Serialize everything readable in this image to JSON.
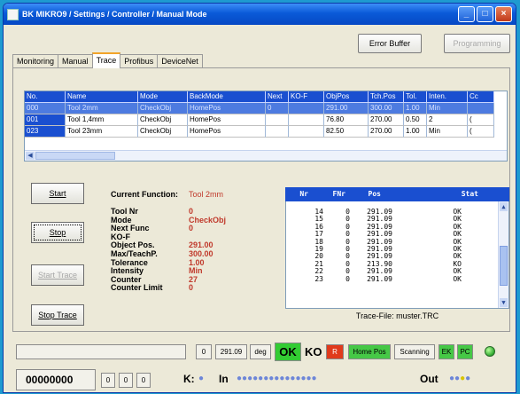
{
  "window": {
    "title": "BK MIKRO9 / Settings / Controller / Manual Mode"
  },
  "toolbar": {
    "error_buffer": "Error Buffer",
    "programming": "Programming"
  },
  "tabs": [
    "Monitoring",
    "Manual",
    "Trace",
    "Profibus",
    "DeviceNet"
  ],
  "grid": {
    "columns": [
      "No.",
      "Name",
      "Mode",
      "BackMode",
      "Next",
      "KO-F",
      "ObjPos",
      "Tch.Pos",
      "Tol.",
      "Inten.",
      "Cc"
    ],
    "rows": [
      [
        "000",
        "Tool 2mm",
        "CheckObj",
        "HomePos",
        "0",
        "",
        "291.00",
        "300.00",
        "1.00",
        "Min",
        ""
      ],
      [
        "001",
        "Tool 1,4mm",
        "CheckObj",
        "HomePos",
        "",
        "",
        "76.80",
        "270.00",
        "0.50",
        "2",
        "("
      ],
      [
        "023",
        "Tool 23mm",
        "CheckObj",
        "HomePos",
        "",
        "",
        "82.50",
        "270.00",
        "1.00",
        "Min",
        "("
      ]
    ]
  },
  "controls": {
    "start": "Start",
    "stop": "Stop",
    "start_trace": "Start Trace",
    "stop_trace": "Stop Trace"
  },
  "info": {
    "current_label": "Current Function:",
    "current_value": "Tool 2mm",
    "rows": [
      {
        "label": "Tool Nr",
        "value": "0"
      },
      {
        "label": "Mode",
        "value": "CheckObj"
      },
      {
        "label": "Next Func",
        "value": "0"
      },
      {
        "label": "KO-F",
        "value": ""
      },
      {
        "label": "Object Pos.",
        "value": "291.00"
      },
      {
        "label": "Max/TeachP.",
        "value": "300.00"
      },
      {
        "label": "Tolerance",
        "value": "1.00"
      },
      {
        "label": "Intensity",
        "value": "Min"
      },
      {
        "label": "Counter",
        "value": "27"
      },
      {
        "label": "Counter Limit",
        "value": "0"
      }
    ]
  },
  "trace": {
    "headers": [
      "Nr",
      "FNr",
      "Pos",
      "Stat"
    ],
    "rows": [
      [
        "14",
        "0",
        "291.09",
        "OK"
      ],
      [
        "15",
        "0",
        "291.09",
        "OK"
      ],
      [
        "16",
        "0",
        "291.09",
        "OK"
      ],
      [
        "17",
        "0",
        "291.09",
        "OK"
      ],
      [
        "18",
        "0",
        "291.09",
        "OK"
      ],
      [
        "19",
        "0",
        "291.09",
        "OK"
      ],
      [
        "20",
        "0",
        "291.09",
        "OK"
      ],
      [
        "21",
        "0",
        "213.90",
        "KO"
      ],
      [
        "22",
        "0",
        "291.09",
        "OK"
      ],
      [
        "23",
        "0",
        "291.09",
        "OK"
      ]
    ],
    "file": "Trace-File: muster.TRC"
  },
  "status": {
    "function_no": "0",
    "position": "291.09",
    "unit": "deg",
    "ok": "OK",
    "ko": "KO",
    "r": "R",
    "home_pos": "Home Pos",
    "scanning": "Scanning",
    "ek": "EK",
    "pc": "PC",
    "counter": "00000000",
    "small": [
      "0",
      "0",
      "0"
    ],
    "k_label": "K:",
    "in_label": "In",
    "out_label": "Out"
  },
  "colors": {
    "title_bar": "#0a5ad8",
    "grid_header": "#1a4fd0",
    "value_red": "#c0392b",
    "ok_green": "#33cc33",
    "ko_red": "#e03a1c",
    "led_green": "#2fa82f"
  }
}
